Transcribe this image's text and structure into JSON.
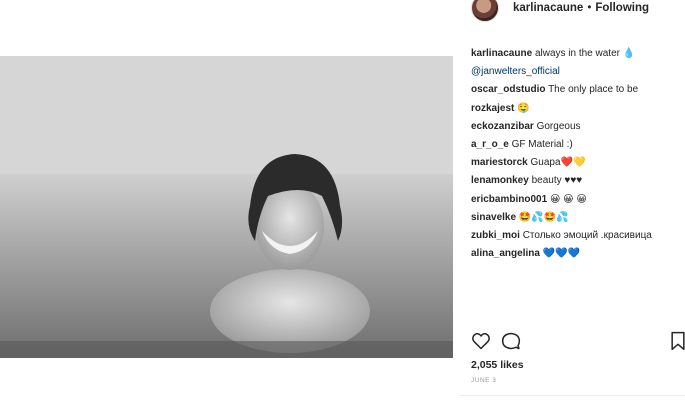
{
  "header": {
    "username": "karlinacaune",
    "separator": "•",
    "follow_status": "Following"
  },
  "comments": [
    {
      "user": "karlinacaune",
      "text": "always in the water",
      "emoji": "💧",
      "emoji_color": "#3fa9f5"
    },
    {
      "user": "",
      "text": "@janwelters_official",
      "emoji": "",
      "mention": true
    },
    {
      "user": "oscar_odstudio",
      "text": "The only place to be",
      "emoji": ""
    },
    {
      "user": "rozkajest",
      "text": "",
      "emoji": "🤤"
    },
    {
      "user": "eckozanzibar",
      "text": "Gorgeous",
      "emoji": ""
    },
    {
      "user": "a_r_o_e",
      "text": "GF Material :)",
      "emoji": ""
    },
    {
      "user": "mariestorck",
      "text": "Guapa",
      "emoji": "❤️💛"
    },
    {
      "user": "lenamonkey",
      "text": "beauty",
      "emoji": "♥♥♥"
    },
    {
      "user": "ericbambino001",
      "text": "",
      "emoji": "😀 😀 😀"
    },
    {
      "user": "sinavelke",
      "text": "",
      "emoji": "🤩💦🤩💦"
    },
    {
      "user": "zubki_moi",
      "text": "Столько эмоций .красивица",
      "emoji": ""
    },
    {
      "user": "alina_angelina",
      "text": "",
      "emoji": "💙💙💙"
    }
  ],
  "actions": {
    "like_icon": "heart-icon",
    "comment_icon": "comment-icon",
    "save_icon": "bookmark-icon"
  },
  "likes": "2,055 likes",
  "date": "JUNE 3",
  "colors": {
    "text": "#262626",
    "muted": "#999999",
    "mention": "#003569"
  }
}
